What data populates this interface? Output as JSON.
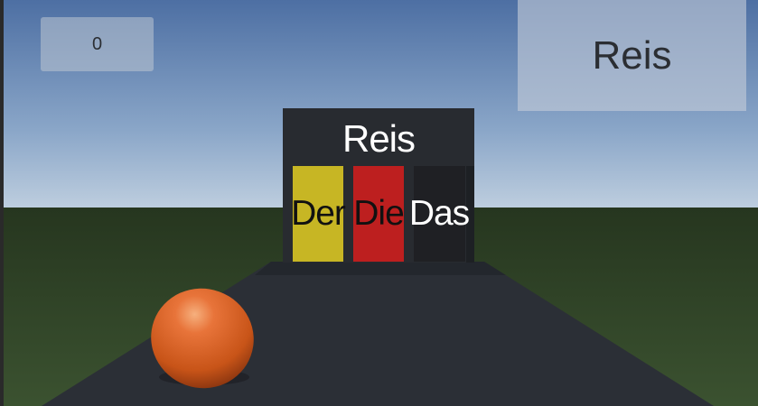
{
  "hud": {
    "score": "0",
    "target_word": "Reis"
  },
  "gate": {
    "word": "Reis",
    "doors": [
      {
        "label": "Der",
        "color": "#c7b624"
      },
      {
        "label": "Die",
        "color": "#bd1f1f"
      },
      {
        "label": "Das",
        "color": "#1f2024"
      }
    ]
  },
  "scene": {
    "sky_top": "#4d6fa3",
    "sky_horizon": "#b7c9dc",
    "ground": "#2f4226",
    "road": "#2b2f36",
    "ball_color": "#e2662b"
  }
}
